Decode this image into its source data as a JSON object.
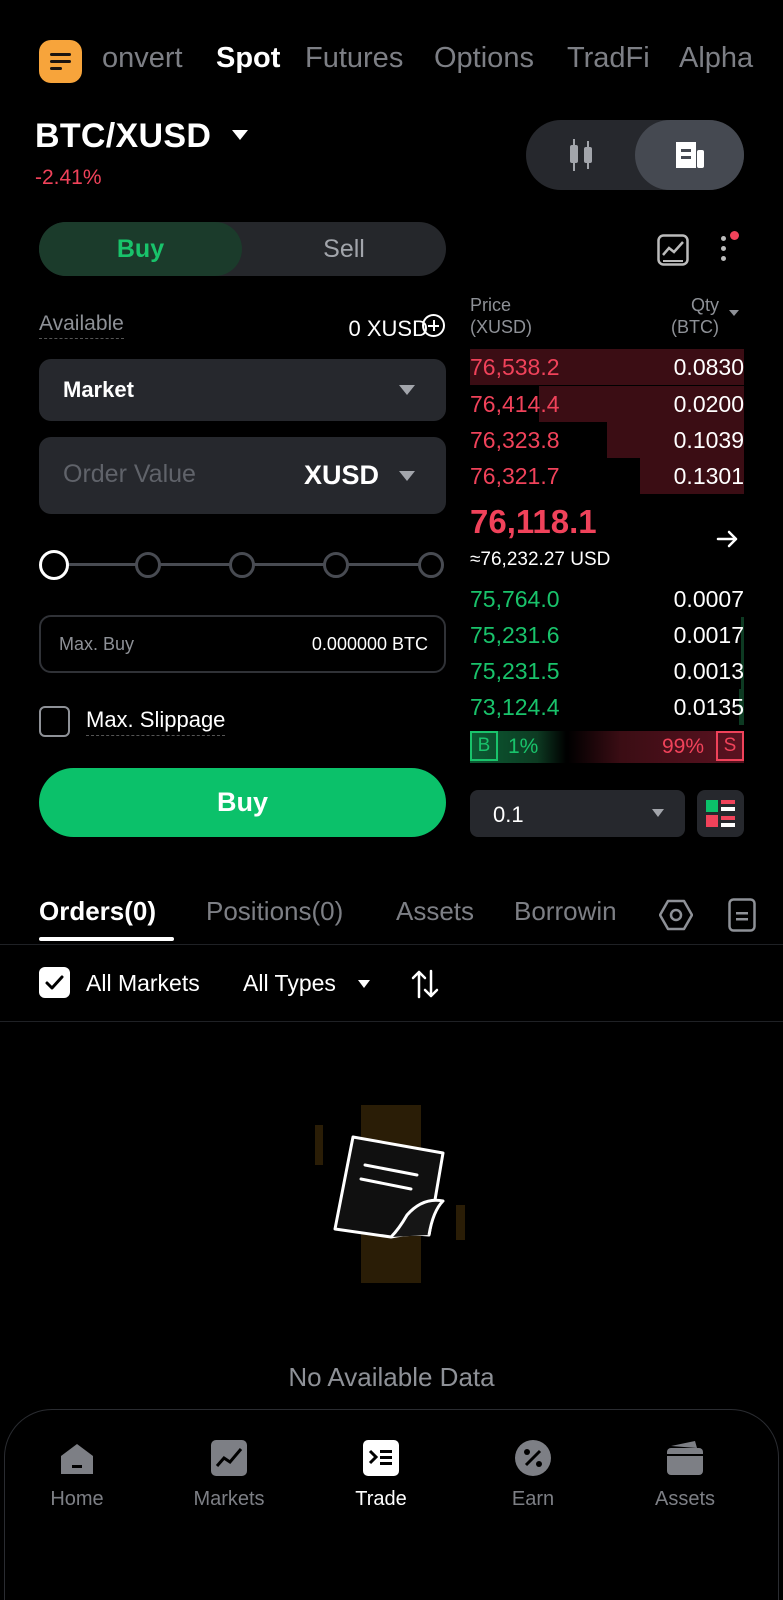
{
  "topnav": {
    "tabs": [
      {
        "label": "onvert",
        "active": false
      },
      {
        "label": "Spot",
        "active": true
      },
      {
        "label": "Futures",
        "active": false
      },
      {
        "label": "Options",
        "active": false
      },
      {
        "label": "TradFi",
        "active": false
      },
      {
        "label": "Alpha",
        "active": false
      }
    ],
    "menu_icon": "menu-icon"
  },
  "pair": {
    "symbol": "BTC/XUSD",
    "change": "-2.41%"
  },
  "view_toggle": {
    "icons": [
      "candlestick-icon",
      "orderbook-icon"
    ],
    "selected": "orderbook-icon"
  },
  "trade": {
    "buy_label": "Buy",
    "sell_label": "Sell",
    "available_label": "Available",
    "available_value": "0 XUSD",
    "order_type": "Market",
    "order_value_placeholder": "Order Value",
    "order_value_unit": "XUSD",
    "slider_level_percent": 0,
    "max_buy_label": "Max. Buy",
    "max_buy_value": "0.000000 BTC",
    "slippage_label": "Max. Slippage",
    "submit_label": "Buy"
  },
  "orderbook": {
    "price_header": "Price",
    "price_unit": "(XUSD)",
    "qty_header": "Qty",
    "qty_unit": "(BTC)",
    "asks": [
      {
        "price": "76,538.2",
        "qty": "0.0830",
        "depth": 1.0
      },
      {
        "price": "76,414.4",
        "qty": "0.0200",
        "depth": 0.75
      },
      {
        "price": "76,323.8",
        "qty": "0.1039",
        "depth": 0.5
      },
      {
        "price": "76,321.7",
        "qty": "0.1301",
        "depth": 0.38
      }
    ],
    "last_price": "76,118.1",
    "last_price_usd": "≈76,232.27 USD",
    "bids": [
      {
        "price": "75,764.0",
        "qty": "0.0007",
        "depth": 0.0
      },
      {
        "price": "75,231.6",
        "qty": "0.0017",
        "depth": 0.01
      },
      {
        "price": "75,231.5",
        "qty": "0.0013",
        "depth": 0.01
      },
      {
        "price": "73,124.4",
        "qty": "0.0135",
        "depth": 0.02
      }
    ],
    "buy_ratio_label": "B",
    "buy_ratio": "1%",
    "sell_ratio": "99%",
    "sell_ratio_label": "S",
    "tick_size": "0.1"
  },
  "orders": {
    "tabs": [
      {
        "label": "Orders(0)",
        "active": true
      },
      {
        "label": "Positions(0)",
        "active": false
      },
      {
        "label": "Assets",
        "active": false
      },
      {
        "label": "Borrowin",
        "active": false
      }
    ],
    "all_markets_label": "All Markets",
    "all_markets_checked": true,
    "all_types_label": "All Types",
    "empty_text": "No Available Data"
  },
  "bottomnav": {
    "items": [
      {
        "label": "Home",
        "icon": "home-icon",
        "active": false
      },
      {
        "label": "Markets",
        "icon": "markets-icon",
        "active": false
      },
      {
        "label": "Trade",
        "icon": "trade-icon",
        "active": true
      },
      {
        "label": "Earn",
        "icon": "earn-icon",
        "active": false
      },
      {
        "label": "Assets",
        "icon": "wallet-icon",
        "active": false
      }
    ]
  },
  "colors": {
    "accent_orange": "#f7a43b",
    "buy_green": "#0bc16a",
    "sell_red": "#f0425a",
    "surface": "#26282d"
  }
}
